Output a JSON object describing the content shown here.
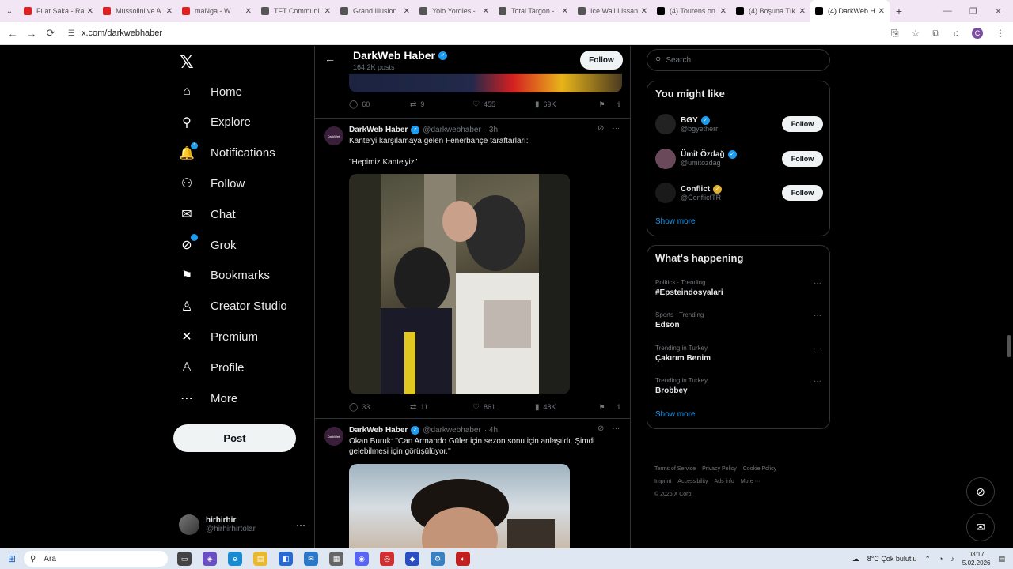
{
  "browser": {
    "tabs": [
      {
        "title": "Fuat Saka - Ra",
        "color": "#e02020"
      },
      {
        "title": "Mussolini ve A",
        "color": "#e02020"
      },
      {
        "title": "maNga - W",
        "color": "#e02020"
      },
      {
        "title": "TFT Communi",
        "color": "#555555"
      },
      {
        "title": "Grand Illusion",
        "color": "#555555"
      },
      {
        "title": "Yolo Yordles -",
        "color": "#555555"
      },
      {
        "title": "Total Targon -",
        "color": "#555555"
      },
      {
        "title": "Ice Wall Lissan",
        "color": "#555555"
      },
      {
        "title": "(4) Tourens on",
        "color": "#000000"
      },
      {
        "title": "(4) Boşuna Tık",
        "color": "#000000"
      },
      {
        "title": "(4) DarkWeb H",
        "color": "#000000"
      }
    ],
    "url": "x.com/darkwebhaber",
    "profile_initial": "C"
  },
  "sidebar": {
    "items": [
      {
        "label": "Home",
        "icon": "⌂"
      },
      {
        "label": "Explore",
        "icon": "⚲"
      },
      {
        "label": "Notifications",
        "icon": "🔔"
      },
      {
        "label": "Follow",
        "icon": "⚇"
      },
      {
        "label": "Chat",
        "icon": "✉"
      },
      {
        "label": "Grok",
        "icon": "⊘"
      },
      {
        "label": "Bookmarks",
        "icon": "⚑"
      },
      {
        "label": "Creator Studio",
        "icon": "♙"
      },
      {
        "label": "Premium",
        "icon": "✕"
      },
      {
        "label": "Profile",
        "icon": "♙"
      },
      {
        "label": "More",
        "icon": "⋯"
      }
    ],
    "notification_badge": "4",
    "post_label": "Post",
    "account": {
      "name": "hirhirhir",
      "handle": "@hirhirhirtolar"
    }
  },
  "header": {
    "name": "DarkWeb Haber",
    "post_count": "164.2K posts",
    "follow_label": "Follow"
  },
  "prev_tweet_actions": {
    "replies": "60",
    "reposts": "9",
    "likes": "455",
    "views": "69K"
  },
  "tweets": [
    {
      "name": "DarkWeb Haber",
      "handle": "@darkwebhaber",
      "time": "· 3h",
      "text_line1": "Kante'yi karşılamaya gelen Fenerbahçe taraftarları:",
      "text_line2": "\"Hepimiz Kante'yiz\"",
      "replies": "33",
      "reposts": "11",
      "likes": "861",
      "views": "48K"
    },
    {
      "name": "DarkWeb Haber",
      "handle": "@darkwebhaber",
      "time": "· 4h",
      "text_line1": "Okan Buruk: \"Can Armando Güler için sezon sonu için anlaşıldı. Şimdi gelebilmesi için görüşülüyor.\""
    }
  ],
  "right": {
    "search_placeholder": "Search",
    "you_might_like": "You might like",
    "suggestions": [
      {
        "name": "BGY",
        "handle": "@bgyetherr",
        "follow": "Follow",
        "badge": "blue"
      },
      {
        "name": "Ümit Özdağ",
        "handle": "@umitozdag",
        "follow": "Follow",
        "badge": "blue"
      },
      {
        "name": "Conflict",
        "handle": "@ConflictTR",
        "follow": "Follow",
        "badge": "gold"
      }
    ],
    "show_more": "Show more",
    "whats_happening": "What's happening",
    "trends": [
      {
        "category": "Politics · Trending",
        "name": "#Epsteindosyalari"
      },
      {
        "category": "Sports · Trending",
        "name": "Edson"
      },
      {
        "category": "Trending in Turkey",
        "name": "Çakırım Benim"
      },
      {
        "category": "Trending in Turkey",
        "name": "Brobbey"
      }
    ],
    "show_more_2": "Show more",
    "footer": [
      "Terms of Service",
      "Privacy Policy",
      "Cookie Policy",
      "Imprint",
      "Accessibility",
      "Ads info",
      "More ···",
      "© 2026 X Corp."
    ]
  },
  "taskbar": {
    "search": "Ara",
    "weather": "8°C  Çok bulutlu",
    "time": "03:17",
    "date": "5.02.2026"
  }
}
